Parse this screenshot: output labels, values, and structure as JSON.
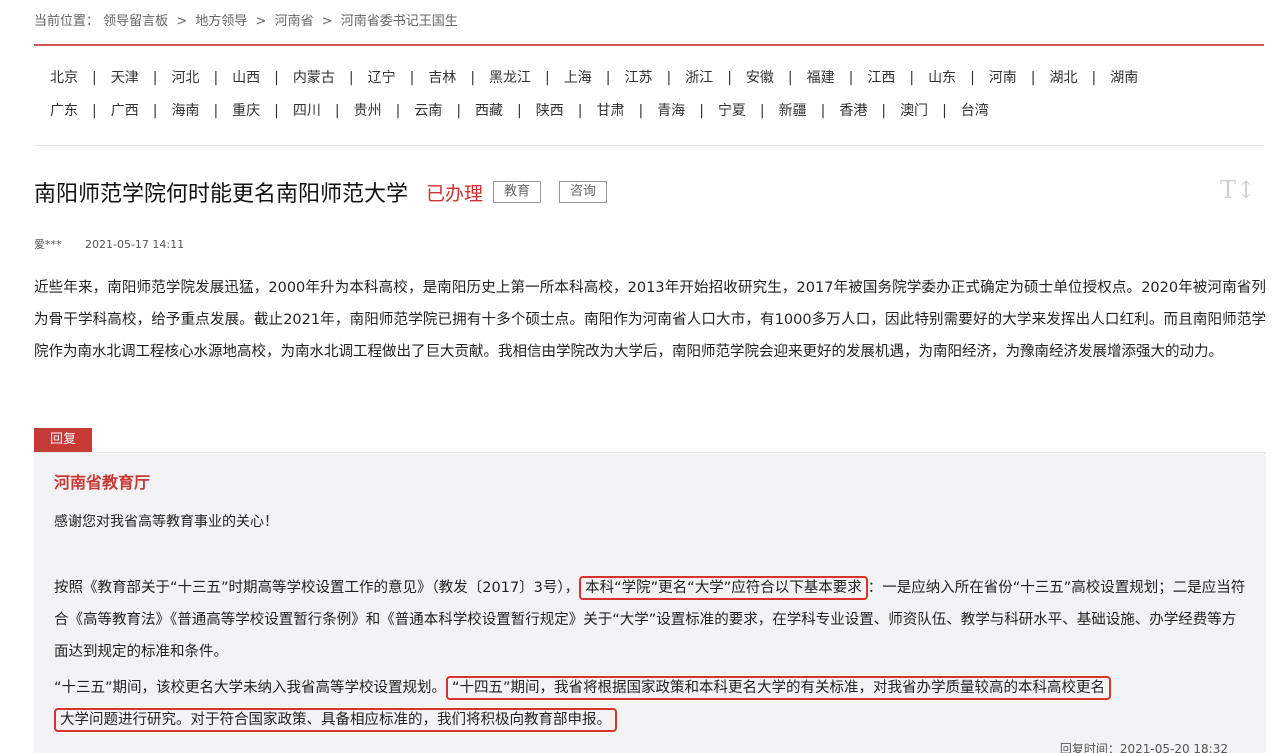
{
  "breadcrumb": {
    "label": "当前位置：",
    "items": [
      "领导留言板",
      "地方领导",
      "河南省",
      "河南省委书记王国生"
    ],
    "separator": ">"
  },
  "provinces": {
    "row1": [
      "北京",
      "天津",
      "河北",
      "山西",
      "内蒙古",
      "辽宁",
      "吉林",
      "黑龙江",
      "上海",
      "江苏",
      "浙江",
      "安徽",
      "福建",
      "江西",
      "山东",
      "河南",
      "湖北",
      "湖南"
    ],
    "row2": [
      "广东",
      "广西",
      "海南",
      "重庆",
      "四川",
      "贵州",
      "云南",
      "西藏",
      "陕西",
      "甘肃",
      "青海",
      "宁夏",
      "新疆",
      "香港",
      "澳门",
      "台湾"
    ],
    "divider": "|"
  },
  "message": {
    "title": "南阳师范学院何时能更名南阳师范大学",
    "status": "已办理",
    "tags": [
      "教育",
      "咨询"
    ],
    "font_toggle_icon": "text-size-icon",
    "author": "爱***",
    "date": "2021-05-17 14:11",
    "body": "近些年来，南阳师范学院发展迅猛，2000年升为本科高校，是南阳历史上第一所本科高校，2013年开始招收研究生，2017年被国务院学委办正式确定为硕士单位授权点。2020年被河南省列为骨干学科高校，给予重点发展。截止2021年，南阳师范学院已拥有十多个硕士点。南阳作为河南省人口大市，有1000多万人口，因此特别需要好的大学来发挥出人口红利。而且南阳师范学院作为南水北调工程核心水源地高校，为南水北调工程做出了巨大贡献。我相信由学院改为大学后，南阳师范学院会迎来更好的发展机遇，为南阳经济，为豫南经济发展增添强大的动力。"
  },
  "reply": {
    "tab_label": "回复",
    "org": "河南省教育厅",
    "greeting": "感谢您对我省高等教育事业的关心！",
    "p1_a": "按照《教育部关于“十三五”时期高等学校设置工作的意见》（教发〔2017〕3号），",
    "p1_highlight": "本科“学院”更名“大学”应符合以下基本要求",
    "p1_b": "：一是应纳入所在省份“十三五”高校设置规划；二是应当符合《高等教育法》《普通高等学校设置暂行条例》和《普通本科学校设置暂行规定》关于“大学”设置标准的要求，在学科专业设置、师资队伍、教学与科研水平、基础设施、办学经费等方面达到规定的标准和条件。",
    "p2_a": "“十三五”期间，该校更名大学未纳入我省高等学校设置规划。",
    "p2_highlight_1": "“十四五”期间，我省将根据国家政策和本科更名大学的有关标准，对我省办学质量较高的本科高校更名",
    "p2_highlight_2": "大学问题进行研究。对于符合国家政策、具备相应标准的，我们将积极向教育部申报。",
    "time_label": "回复时间：",
    "time": "2021-05-20 18:32"
  },
  "colors": {
    "accent": "#c63a35",
    "highlight_border": "#d9332e",
    "reply_bg": "#f3f3f5"
  }
}
